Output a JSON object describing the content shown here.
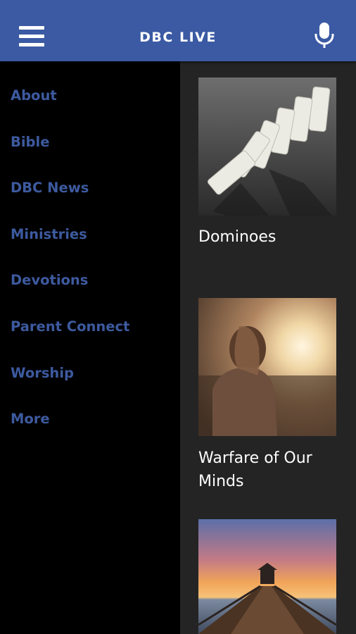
{
  "header": {
    "title": "DBC LIVE",
    "menu_icon": "hamburger-menu-icon",
    "mic_icon": "microphone-icon",
    "bar_color": "#3b5aa3"
  },
  "drawer": {
    "items": [
      {
        "label": "About"
      },
      {
        "label": "Bible"
      },
      {
        "label": "DBC News"
      },
      {
        "label": "Ministries"
      },
      {
        "label": "Devotions"
      },
      {
        "label": "Parent Connect"
      },
      {
        "label": "Worship"
      },
      {
        "label": "More"
      }
    ],
    "item_color": "#3d5a9f"
  },
  "feed": {
    "cards": [
      {
        "title": "Dominoes",
        "image": "dominoes-photo"
      },
      {
        "title": "Warfare of Our Minds",
        "image": "woman-sunset-photo"
      },
      {
        "title": "",
        "image": "pier-sunset-photo"
      }
    ]
  }
}
